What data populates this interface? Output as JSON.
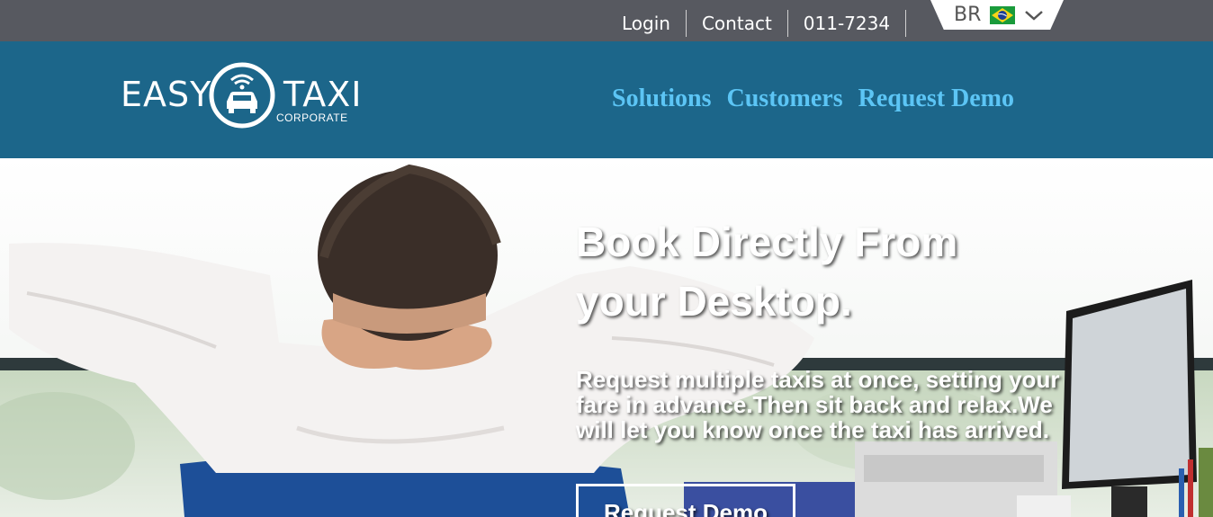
{
  "topbar": {
    "links": [
      "Login",
      "Contact",
      "011-7234"
    ],
    "language": {
      "code": "BR",
      "flag": "brazil-flag"
    }
  },
  "header": {
    "logo": {
      "word_left": "EASY",
      "word_right": "TAXI",
      "sub": "CORPORATE"
    },
    "nav": [
      "Solutions",
      "Customers",
      "Request Demo"
    ]
  },
  "hero": {
    "title_line1": "Book Directly From",
    "title_line2": "your Desktop.",
    "text": "Request multiple taxis at once, setting your fare in advance.Then sit back and relax.We will let you know once the taxi has arrived.",
    "button": "Request Demo"
  },
  "colors": {
    "topbar": "#575960",
    "header": "#1c668a",
    "nav_link": "#5cc5f5"
  }
}
